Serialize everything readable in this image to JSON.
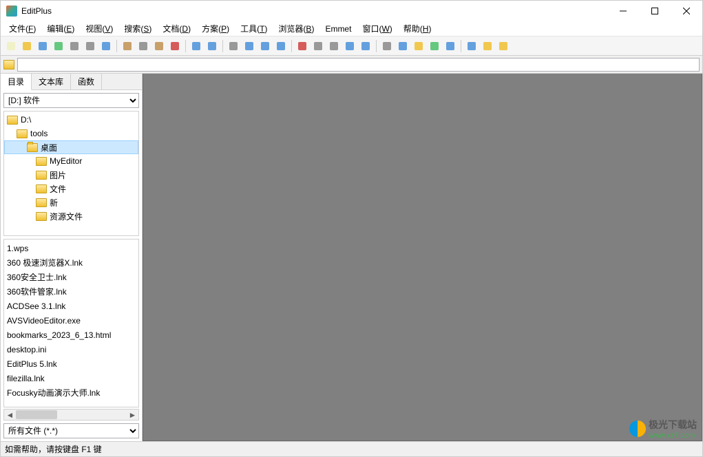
{
  "app": {
    "title": "EditPlus"
  },
  "menus": [
    {
      "label": "文件",
      "key": "F"
    },
    {
      "label": "编辑",
      "key": "E"
    },
    {
      "label": "视图",
      "key": "V"
    },
    {
      "label": "搜索",
      "key": "S"
    },
    {
      "label": "文档",
      "key": "D"
    },
    {
      "label": "方案",
      "key": "P"
    },
    {
      "label": "工具",
      "key": "T"
    },
    {
      "label": "浏览器",
      "key": "B"
    },
    {
      "label": "Emmet",
      "key": ""
    },
    {
      "label": "窗口",
      "key": "W"
    },
    {
      "label": "帮助",
      "key": "H"
    }
  ],
  "toolbar_groups": [
    [
      "new-file",
      "open-file",
      "save",
      "save-all",
      "print",
      "print-preview",
      "toggle"
    ],
    [
      "cut",
      "copy",
      "paste",
      "delete"
    ],
    [
      "undo",
      "redo"
    ],
    [
      "find",
      "find-next",
      "replace",
      "goto"
    ],
    [
      "font",
      "word-wrap",
      "whitespace",
      "indent",
      "outdent"
    ],
    [
      "settings",
      "window-1",
      "window-2",
      "window-3",
      "window-4"
    ],
    [
      "browser",
      "refresh",
      "help"
    ]
  ],
  "toolbar_colors": {
    "new-file": "#f0f0c0",
    "open-file": "#f0c030",
    "save": "#4a90d9",
    "save-all": "#4ac06a",
    "print": "#888",
    "print-preview": "#888",
    "toggle": "#4a90d9",
    "cut": "#c09050",
    "copy": "#888",
    "paste": "#c09050",
    "delete": "#d04040",
    "undo": "#4a90d9",
    "redo": "#4a90d9",
    "find": "#888",
    "find-next": "#4a90d9",
    "replace": "#4a90d9",
    "goto": "#4a90d9",
    "font": "#d04040",
    "word-wrap": "#888",
    "whitespace": "#888",
    "indent": "#4a90d9",
    "outdent": "#4a90d9",
    "settings": "#888",
    "window-1": "#4a90d9",
    "window-2": "#f0c030",
    "window-3": "#4ac06a",
    "window-4": "#4a90d9",
    "browser": "#4a90d9",
    "refresh": "#f0c030",
    "help": "#f0c030"
  },
  "addressbar": {
    "value": ""
  },
  "sidebar": {
    "tabs": [
      {
        "label": "目录",
        "active": true
      },
      {
        "label": "文本库",
        "active": false
      },
      {
        "label": "函数",
        "active": false
      }
    ],
    "drive": "[D:] 软件",
    "tree": [
      {
        "label": "D:\\",
        "indent": 0,
        "selected": false
      },
      {
        "label": "tools",
        "indent": 1,
        "selected": false
      },
      {
        "label": "桌面",
        "indent": 2,
        "selected": true
      },
      {
        "label": "MyEditor",
        "indent": 3,
        "selected": false
      },
      {
        "label": "图片",
        "indent": 3,
        "selected": false
      },
      {
        "label": "文件",
        "indent": 3,
        "selected": false
      },
      {
        "label": "新",
        "indent": 3,
        "selected": false
      },
      {
        "label": "资源文件",
        "indent": 3,
        "selected": false
      }
    ],
    "files": [
      "1.wps",
      "360 极速浏览器X.lnk",
      "360安全卫士.lnk",
      "360软件管家.lnk",
      "ACDSee 3.1.lnk",
      "AVSVideoEditor.exe",
      "bookmarks_2023_6_13.html",
      "desktop.ini",
      "EditPlus 5.lnk",
      "filezilla.lnk",
      "Focusky动画演示大师.lnk"
    ],
    "filter": "所有文件 (*.*)"
  },
  "statusbar": {
    "text": "如需帮助，请按键盘 F1 键"
  },
  "watermark": {
    "name": "极光下载站",
    "url": "www.xz7.com"
  }
}
